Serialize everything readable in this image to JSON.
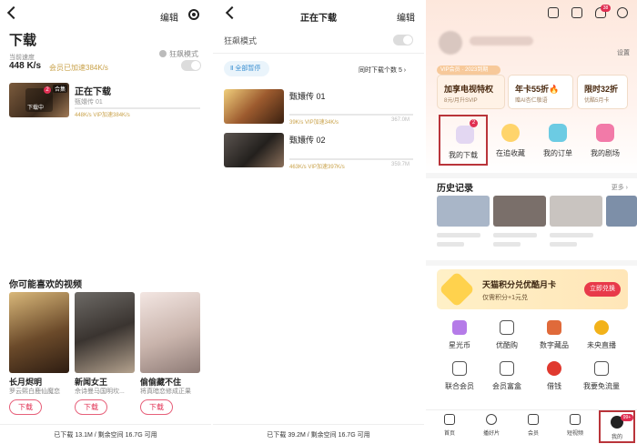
{
  "screen1": {
    "edit_label": "编辑",
    "title": "下载",
    "speed_label": "当前速度",
    "speed_value": "448 K/s",
    "vip_accel": "会员已加速384K/s",
    "crazy_mode": "狂飙模式",
    "downloading": {
      "badge": "合集",
      "overlay": "下载中",
      "title": "正在下载",
      "subtitle": "甄嬛传 01",
      "stat": "448K/s VIP加速384K/s"
    },
    "recommend_title": "你可能喜欢的视频",
    "recommendations": [
      {
        "name": "长月烬明",
        "desc": "罗云熙白鹿仙魔恋",
        "button": "下载"
      },
      {
        "name": "新闻女王",
        "desc": "佘诗曼马国明坎...",
        "button": "下载"
      },
      {
        "name": "偷偷藏不住",
        "desc": "将真暗恋修成正果",
        "button": "下载"
      }
    ],
    "footer": "已下载 13.1M / 剩余空间 16.7G 可用"
  },
  "screen2": {
    "title": "正在下载",
    "edit_label": "编辑",
    "crazy_mode": "狂飙模式",
    "pause_all": "全部暂停",
    "concurrent": "同时下载个数 5",
    "items": [
      {
        "name": "甄嬛传 01",
        "stat": "39K/s VIP加速34K/s",
        "size": "367.0M"
      },
      {
        "name": "甄嬛传 02",
        "stat": "463K/s VIP加速397K/s",
        "size": "359.7M"
      }
    ],
    "footer": "已下载 39.2M / 剩余空间 16.7G 可用"
  },
  "screen3": {
    "notif_count": "38",
    "settings": "设置",
    "vip_bar": "VIP会员 · 2023到期",
    "cards": [
      {
        "title": "加享电视特权",
        "sub": "8元/月升SVIP"
      },
      {
        "title": "年卡55折🔥",
        "sub": "赠AI杏仁敬语"
      },
      {
        "title": "限时32折",
        "sub": "优酷5月卡"
      }
    ],
    "quick": [
      {
        "label": "我的下载",
        "badge": "2"
      },
      {
        "label": "在追收藏"
      },
      {
        "label": "我的订单"
      },
      {
        "label": "我的剧场"
      }
    ],
    "history_title": "历史记录",
    "history_more": "更多",
    "banner": {
      "title": "天猫积分兑优酷月卡",
      "sub": "仅需积分+1元兑",
      "button": "立即兑换"
    },
    "grid": [
      {
        "label": "星光币",
        "color": "#b57be8"
      },
      {
        "label": "优酷购",
        "color": "#555555"
      },
      {
        "label": "数字藏品",
        "color": "#e06a3a"
      },
      {
        "label": "未央直播",
        "color": "#f2b21a"
      },
      {
        "label": "联合会员",
        "color": "#555555"
      },
      {
        "label": "会员富盒",
        "color": "#555555"
      },
      {
        "label": "借钱",
        "color": "#e0392f"
      },
      {
        "label": "我要免流量",
        "color": "#555555"
      }
    ],
    "tabs": [
      {
        "label": "首页"
      },
      {
        "label": "播好片"
      },
      {
        "label": "会员"
      },
      {
        "label": "短视频"
      },
      {
        "label": "我的"
      }
    ],
    "tab_badge": "99+"
  }
}
